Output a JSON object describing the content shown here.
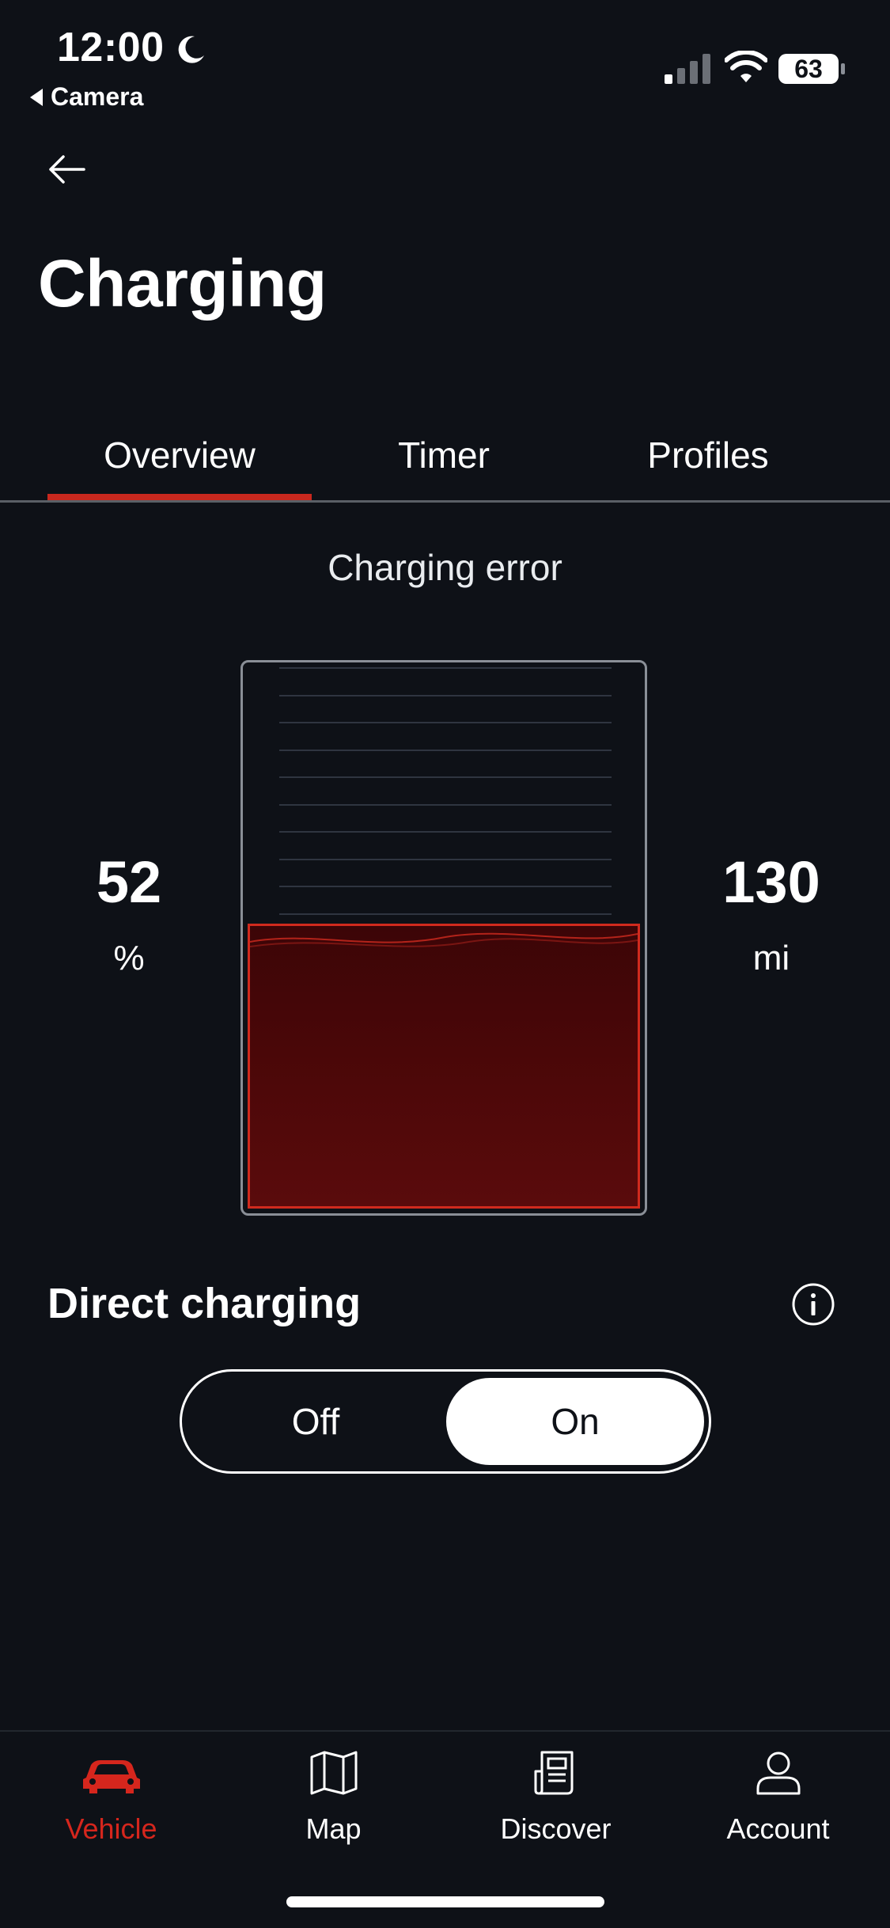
{
  "status_bar": {
    "time": "12:00",
    "back_app": "Camera",
    "battery_level": "63",
    "icons": [
      "moon-icon",
      "signal-icon",
      "wifi-icon",
      "battery-icon"
    ]
  },
  "header": {
    "back_icon": "arrow-left-icon",
    "title": "Charging"
  },
  "tabs": [
    {
      "label": "Overview",
      "active": true
    },
    {
      "label": "Timer",
      "active": false
    },
    {
      "label": "Profiles",
      "active": false
    }
  ],
  "charging": {
    "status": "Charging error",
    "state_of_charge": "52",
    "state_of_charge_unit": "%",
    "state_of_charge_fraction": 0.52,
    "range": "130",
    "range_unit": "mi"
  },
  "direct_charging": {
    "title": "Direct charging",
    "info_icon": "info-icon",
    "options": [
      "Off",
      "On"
    ],
    "selected": "On"
  },
  "bottom_nav": [
    {
      "label": "Vehicle",
      "icon": "car-icon",
      "active": true
    },
    {
      "label": "Map",
      "icon": "map-icon",
      "active": false
    },
    {
      "label": "Discover",
      "icon": "news-icon",
      "active": false
    },
    {
      "label": "Account",
      "icon": "user-icon",
      "active": false
    }
  ],
  "colors": {
    "background": "#0e1117",
    "accent": "#d5261d",
    "text": "#ffffff"
  }
}
